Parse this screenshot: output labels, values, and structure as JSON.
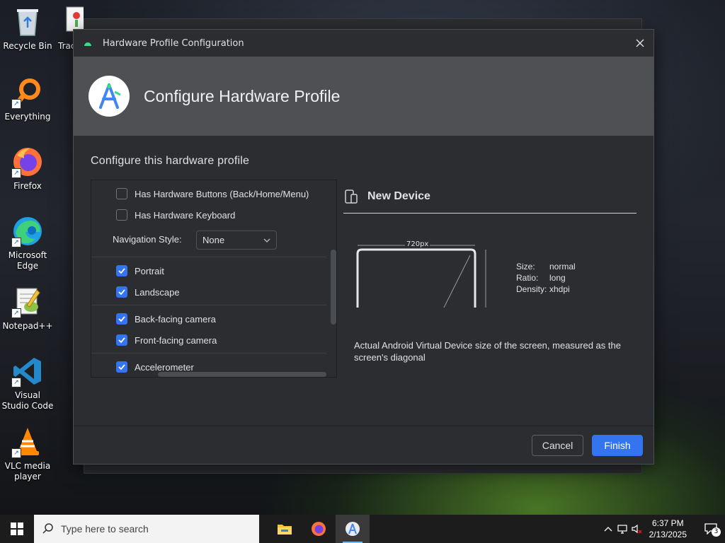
{
  "desktop": {
    "icons": [
      {
        "label": "Recycle Bin",
        "icon": "recycle-bin-icon"
      },
      {
        "label": "Everything",
        "icon": "search-magnifier-icon"
      },
      {
        "label": "Firefox",
        "icon": "firefox-icon"
      },
      {
        "label": "Microsoft Edge",
        "icon": "edge-icon"
      },
      {
        "label": "Notepad++",
        "icon": "notepad-plus-plus-icon"
      },
      {
        "label": "Visual Studio Code",
        "icon": "vscode-icon"
      },
      {
        "label": "VLC media player",
        "icon": "vlc-icon"
      }
    ],
    "partial_icon_label": "Trac"
  },
  "dialog": {
    "window_title": "Hardware Profile Configuration",
    "banner_title": "Configure Hardware Profile",
    "section_title": "Configure this hardware profile",
    "options": {
      "has_hardware_buttons": {
        "label": "Has Hardware Buttons (Back/Home/Menu)",
        "checked": false
      },
      "has_hardware_keyboard": {
        "label": "Has Hardware Keyboard",
        "checked": false
      },
      "navigation_style": {
        "label": "Navigation Style:",
        "value": "None"
      },
      "portrait": {
        "label": "Portrait",
        "checked": true
      },
      "landscape": {
        "label": "Landscape",
        "checked": true
      },
      "back_camera": {
        "label": "Back-facing camera",
        "checked": true
      },
      "front_camera": {
        "label": "Front-facing camera",
        "checked": true
      },
      "accelerometer": {
        "label": "Accelerometer",
        "checked": true
      }
    },
    "device": {
      "name": "New Device",
      "width_label": "720px",
      "specs": [
        {
          "key": "Size:",
          "value": "normal"
        },
        {
          "key": "Ratio:",
          "value": "long"
        },
        {
          "key": "Density:",
          "value": "xhdpi"
        }
      ],
      "description": "Actual Android Virtual Device size of the screen, measured as the screen's diagonal"
    },
    "buttons": {
      "cancel": "Cancel",
      "finish": "Finish"
    }
  },
  "taskbar": {
    "search_placeholder": "Type here to search",
    "apps": [
      "file-explorer-icon",
      "firefox-icon",
      "android-studio-icon"
    ],
    "time": "6:37 PM",
    "date": "2/13/2025",
    "notification_count": "3"
  },
  "colors": {
    "accent": "#3574f0",
    "dialog_bg": "#2b2d30",
    "banner_bg": "#4e5053"
  }
}
